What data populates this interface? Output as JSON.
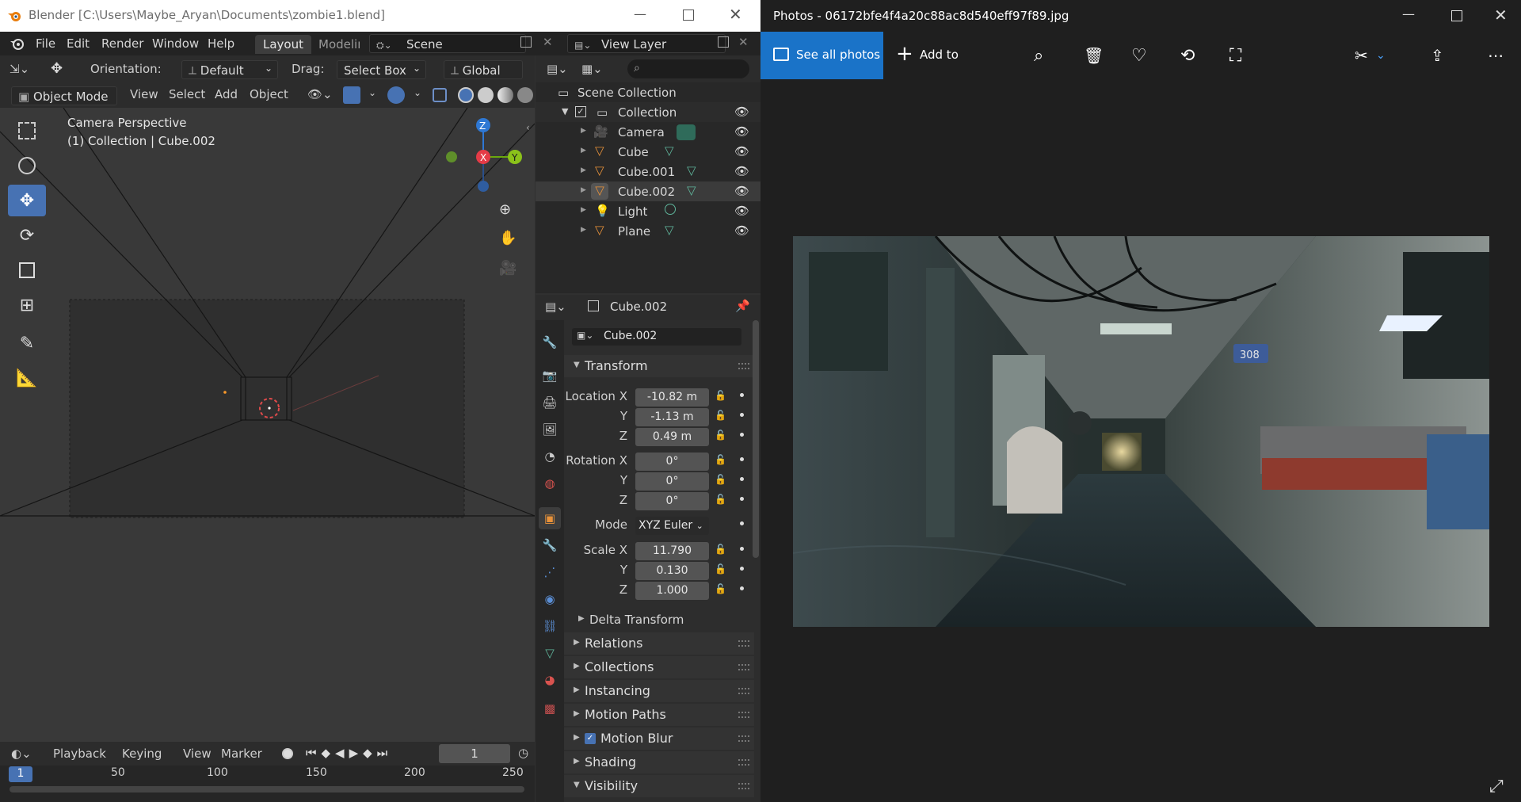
{
  "blender": {
    "window_title": "Blender [C:\\Users\\Maybe_Aryan\\Documents\\zombie1.blend]",
    "menu": [
      "File",
      "Edit",
      "Render",
      "Window",
      "Help"
    ],
    "workspace_tabs": [
      "Layout",
      "Modeling"
    ],
    "scene": "Scene",
    "view_layer": "View Layer",
    "header": {
      "orientation_label": "Orientation:",
      "orientation_value": "Default",
      "drag_label": "Drag:",
      "drag_value": "Select Box",
      "transform_orientation": "Global"
    },
    "header2": {
      "mode": "Object Mode",
      "menus": [
        "View",
        "Select",
        "Add",
        "Object"
      ]
    },
    "viewport": {
      "overlay_title": "Camera Perspective",
      "overlay_sub": "(1) Collection | Cube.002",
      "gizmo": {
        "z": "Z",
        "x": "X",
        "y": "Y"
      }
    },
    "outliner": {
      "scene_collection": "Scene Collection",
      "collection": "Collection",
      "items": [
        "Camera",
        "Cube",
        "Cube.001",
        "Cube.002",
        "Light",
        "Plane"
      ],
      "selected": "Cube.002"
    },
    "properties": {
      "object_name_header": "Cube.002",
      "object_name_field": "Cube.002",
      "transform_label": "Transform",
      "location_label": "Location X",
      "location": [
        "-10.82 m",
        "-1.13 m",
        "0.49 m"
      ],
      "rotation_label": "Rotation X",
      "rotation": [
        "0°",
        "0°",
        "0°"
      ],
      "mode_label": "Mode",
      "mode_value": "XYZ Euler",
      "scale_label": "Scale X",
      "scale": [
        "11.790",
        "0.130",
        "1.000"
      ],
      "axis_y": "Y",
      "axis_z": "Z",
      "delta_transform": "Delta Transform",
      "panels": [
        "Relations",
        "Collections",
        "Instancing",
        "Motion Paths",
        "Motion Blur",
        "Shading",
        "Visibility"
      ]
    },
    "timeline": {
      "menus": [
        "Playback",
        "Keying",
        "View",
        "Marker"
      ],
      "current_frame": "1",
      "ruler_current": "1",
      "ruler": [
        "50",
        "100",
        "150",
        "200",
        "250"
      ]
    }
  },
  "photos": {
    "window_title": "Photos - 06172bfe4f4a20c88ac8d540eff97f89.jpg",
    "see_all": "See all photos",
    "add_to": "Add to",
    "door_sign": "308",
    "accent": "#1a73c8"
  }
}
